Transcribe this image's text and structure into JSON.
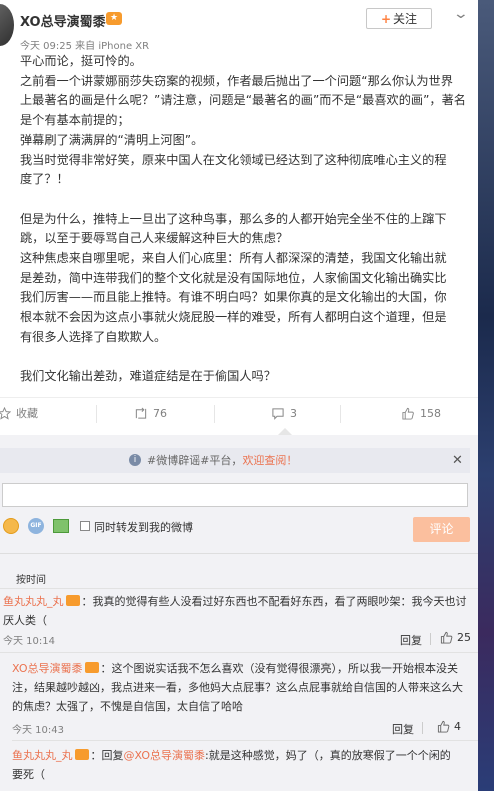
{
  "post": {
    "author": "XO总导演蜀黍",
    "follow_label": "关注",
    "meta": "今天 09:25 来自 iPhone XR",
    "lines": [
      "平心而论，挺可怜的。",
      "之前看一个讲蒙娜丽莎失窃案的视频，作者最后抛出了一个问题“那么你认为世界",
      "上最著名的画是什么呢？”请注意，问题是“最著名的画”而不是“最喜欢的画”，著名",
      "是个有基本前提的；",
      "弹幕刷了满满屏的“清明上河图”。",
      "我当时觉得非常好笑，原来中国人在文化领域已经达到了这种彻底唯心主义的程",
      "度了？！",
      "",
      "但是为什么，推特上一旦出了这种鸟事，那么多的人都开始完全坐不住的上蹿下",
      "跳，以至于要辱骂自己人来缓解这种巨大的焦虑？",
      "这种焦虑来自哪里呢，来自人们心底里：所有人都深深的清楚，我国文化输出就",
      "是差劲，简中连带我们的整个文化就是没有国际地位，人家偷国文化输出确实比",
      "我们厉害——而且能上推特。有谁不明白吗？如果你真的是文化输出的大国，你",
      "根本就不会因为这点小事就火烧屁股一样的难受，所有人都明白这个道理，但是",
      "有很多人选择了自欺欺人。",
      "",
      "我们文化输出差劲，难道症结是在于偷国人吗？"
    ]
  },
  "actions": {
    "favorite_label": "收藏",
    "repost_count": "76",
    "comment_count": "3",
    "like_count": "158"
  },
  "comment_box": {
    "notice_text": "#微博辟谣#平台，",
    "notice_link": "欢迎查阅！",
    "input_value": "",
    "sync_label": "同时转发到我的微博",
    "submit_label": "评论",
    "gif_label": "GIF",
    "sort_label": "按时间"
  },
  "comments": [
    {
      "user": "鱼丸丸丸_丸",
      "text_line1": "：我真的觉得有些人没看过好东西也不配看好东西，看了两眼吵架：我今天也讨",
      "text_line2": "厌人类（",
      "time": "今天 10:14",
      "reply_label": "回复",
      "likes": "25"
    },
    {
      "user": "XO总导演蜀黍",
      "text_line1": "：这个图说实话我不怎么喜欢（没有觉得很漂亮），所以我一开始根本没关",
      "text_line2": "注，结果越吵越凶，我点进来一看，多他妈大点屁事？这么点屁事就给自信国的人带来这么大",
      "text_line3": "的焦虑？太强了，不愧是自信国，太自信了哈哈",
      "time": "今天 10:43",
      "reply_label": "回复",
      "likes": "4"
    },
    {
      "user": "鱼丸丸丸_丸",
      "text_prefix": "：回复",
      "mention": "@XO总导演蜀黍",
      "text_line1": ":就是这种感觉，妈了（，真的放寒假了一个个闲的",
      "text_line2": "要死（"
    }
  ],
  "colors": {
    "accent": "#eb7350",
    "submit_disabled": "#fbbf9e",
    "badge": "#f79b2d"
  }
}
